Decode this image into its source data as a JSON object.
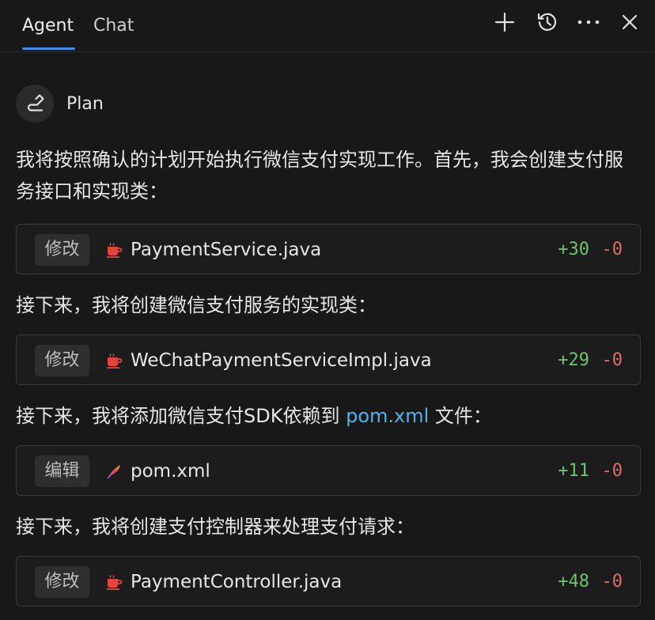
{
  "header": {
    "tabs": [
      {
        "label": "Agent",
        "active": true
      },
      {
        "label": "Chat",
        "active": false
      }
    ],
    "actions": [
      "plus-icon",
      "history-icon",
      "more-icon",
      "close-icon"
    ]
  },
  "mode": {
    "icon": "route-icon",
    "label": "Plan"
  },
  "messages": [
    {
      "text": "我将按照确认的计划开始执行微信支付实现工作。首先，我会创建支付服务接口和实现类："
    },
    {
      "text": "接下来，我将创建微信支付服务的实现类："
    },
    {
      "before": "接下来，我将添加微信支付SDK依赖到 ",
      "link": "pom.xml",
      "after": " 文件："
    },
    {
      "text": "接下来，我将创建支付控制器来处理支付请求："
    }
  ],
  "file_changes": [
    {
      "action": "修改",
      "icon": "java-icon",
      "file": "PaymentService.java",
      "added": "+30",
      "removed": "-0"
    },
    {
      "action": "修改",
      "icon": "java-icon",
      "file": "WeChatPaymentServiceImpl.java",
      "added": "+29",
      "removed": "-0"
    },
    {
      "action": "编辑",
      "icon": "xml-feather-icon",
      "file": "pom.xml",
      "added": "+11",
      "removed": "-0"
    },
    {
      "action": "修改",
      "icon": "java-icon",
      "file": "PaymentController.java",
      "added": "+48",
      "removed": "-0"
    }
  ],
  "colors": {
    "background": "#181818",
    "accent": "#3b8eea",
    "link": "#4fb3e8",
    "added": "#6cc46c",
    "removed": "#e06c6c",
    "java_icon": "#e2463f"
  }
}
